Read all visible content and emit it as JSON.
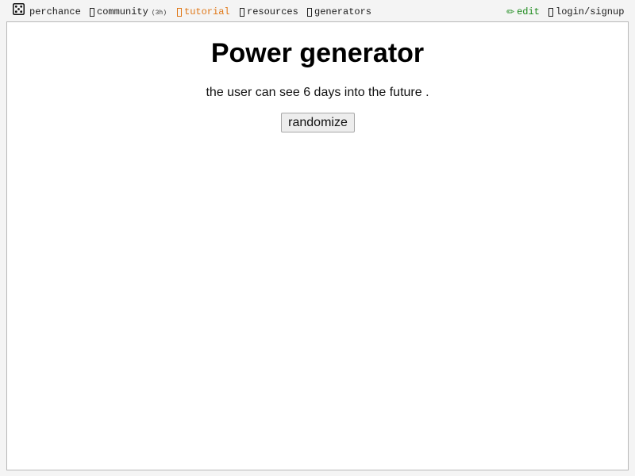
{
  "nav": {
    "logo_label": "perchance",
    "community_label": "community",
    "community_badge": "(3h)",
    "tutorial_label": "tutorial",
    "resources_label": "resources",
    "generators_label": "generators",
    "edit_label": "edit",
    "login_label": "login/signup"
  },
  "main": {
    "title": "Power generator",
    "output_text": "the user can see 6 days into the future .",
    "randomize_label": "randomize"
  },
  "colors": {
    "tutorial": "#e07818",
    "edit": "#1c8a1c",
    "background": "#f4f4f4"
  }
}
